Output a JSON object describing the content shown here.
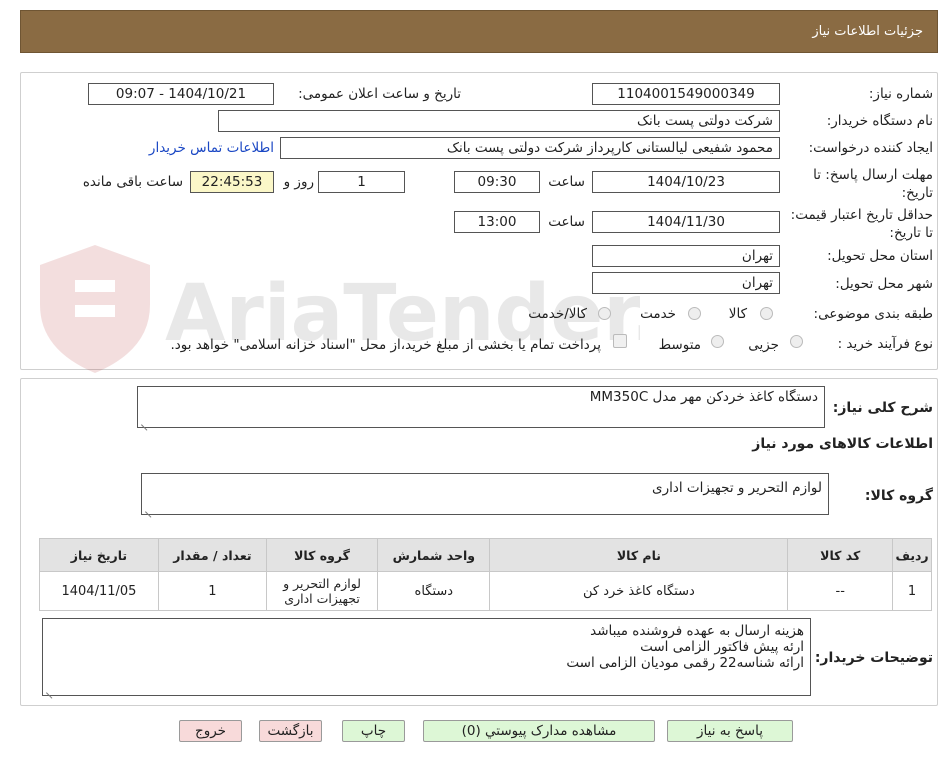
{
  "header": {
    "title": "جزئیات اطلاعات نیاز"
  },
  "form": {
    "need_number_label": "شماره نیاز:",
    "need_number": "1104001549000349",
    "announce_label": "تاریخ و ساعت اعلان عمومی:",
    "announce_value": "1404/10/21 - 09:07",
    "buyer_org_label": "نام دستگاه خریدار:",
    "buyer_org": "شرکت دولتی پست بانک",
    "creator_label": "ایجاد کننده درخواست:",
    "creator": "محمود شفیعی لیالستانی کارپرداز شرکت دولتی پست بانک",
    "contact_link": "اطلاعات تماس خریدار",
    "reply_deadline_label": "مهلت ارسال پاسخ: تا تاریخ:",
    "reply_date": "1404/10/23",
    "time_label": "ساعت",
    "reply_time": "09:30",
    "days_value": "1",
    "days_label": "روز و",
    "remaining_time": "22:45:53",
    "remaining_label": "ساعت باقی مانده",
    "price_validity_label": "حداقل تاریخ اعتبار قیمت: تا تاریخ:",
    "validity_date": "1404/11/30",
    "validity_time": "13:00",
    "province_label": "استان محل تحویل:",
    "province": "تهران",
    "city_label": "شهر محل تحویل:",
    "city": "تهران",
    "category_label": "طبقه بندی موضوعی:",
    "category_options": [
      "کالا",
      "خدمت",
      "کالا/خدمت"
    ],
    "process_label": "نوع فرآیند خرید :",
    "process_options": [
      "جزیی",
      "متوسط"
    ],
    "payment_note": "پرداخت تمام یا بخشی از مبلغ خرید،از محل \"اسناد خزانه اسلامی\" خواهد بود."
  },
  "details": {
    "summary_label": "شرح کلی نیاز:",
    "summary": "دستگاه کاغذ خردکن مهر مدل MM350C",
    "goods_info_title": "اطلاعات کالاهای مورد نیاز",
    "goods_group_label": "گروه کالا:",
    "goods_group": "لوازم التحریر و تجهیزات اداری",
    "table": {
      "headers": [
        "ردیف",
        "کد کالا",
        "نام کالا",
        "واحد شمارش",
        "گروه کالا",
        "تعداد / مقدار",
        "تاریخ نیاز"
      ],
      "rows": [
        [
          "1",
          "--",
          "دستگاه کاغذ خرد کن",
          "دستگاه",
          "لوازم التحریر و تجهیزات اداری",
          "1",
          "1404/11/05"
        ]
      ]
    },
    "buyer_notes_label": "توضیحات خریدار:",
    "buyer_notes": [
      "هزینه ارسال به عهده فروشنده میباشد",
      "ارئه پیش فاکتور الزامی است",
      "ارائه شناسه22 رقمی مودیان الزامی است"
    ]
  },
  "buttons": {
    "reply": "پاسخ به نیاز",
    "view_docs": "مشاهده مدارک پیوستي (0)",
    "print": "چاپ",
    "back": "بازگشت",
    "exit": "خروج"
  },
  "watermark": {
    "text": "AriaTender.neT"
  },
  "colors": {
    "header_bg": "#8a6b43",
    "link": "#1a47c4",
    "remaining_bg": "#fbf7c8",
    "button_green": "#ddf7d6",
    "button_pink": "#f8dada"
  }
}
